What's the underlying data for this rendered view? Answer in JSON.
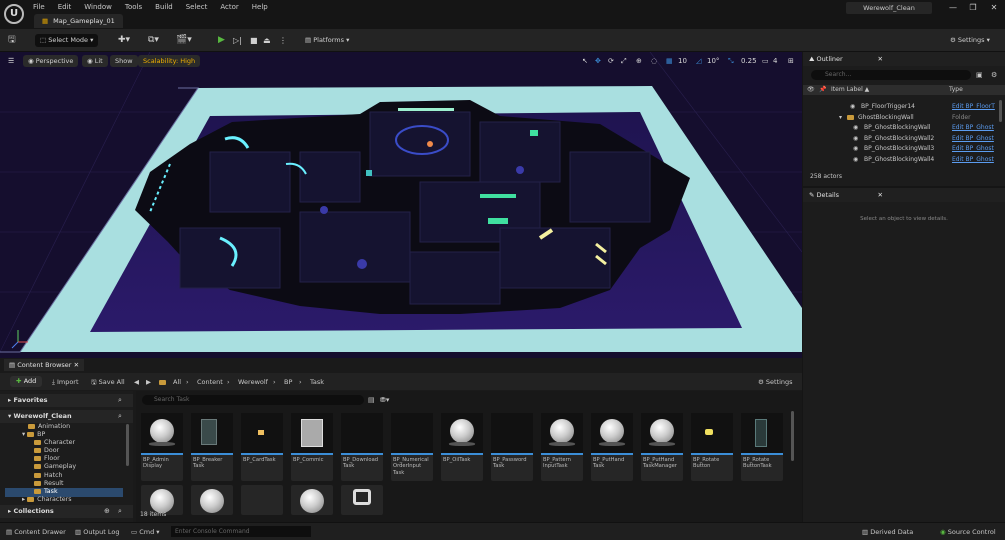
{
  "menu": [
    "File",
    "Edit",
    "Window",
    "Tools",
    "Build",
    "Select",
    "Actor",
    "Help"
  ],
  "map_tab": "Map_Gameplay_01",
  "project_name": "Werewolf_Clean",
  "toolbar": {
    "select_mode": "Select Mode",
    "platforms": "Platforms",
    "settings": "Settings"
  },
  "viewport": {
    "perspective": "Perspective",
    "lit": "Lit",
    "show": "Show",
    "scalability": "Scalability: High",
    "grid_snap": "10",
    "rot_snap": "10°",
    "scale_snap": "0.25",
    "cam_speed": "4"
  },
  "outliner": {
    "tab": "Outliner",
    "search_placeholder": "Search...",
    "col_label": "Item Label ▲",
    "col_type": "Type",
    "rows": [
      {
        "name": "BP_FloorTrigger14",
        "type": "Edit BP_FloorT"
      },
      {
        "name": "GhostBlockingWall",
        "type": "Folder"
      },
      {
        "name": "BP_GhostBlockingWall",
        "type": "Edit BP_Ghost"
      },
      {
        "name": "BP_GhostBlockingWall2",
        "type": "Edit BP_Ghost"
      },
      {
        "name": "BP_GhostBlockingWall3",
        "type": "Edit BP_Ghost"
      },
      {
        "name": "BP_GhostBlockingWall4",
        "type": "Edit BP_Ghost"
      }
    ],
    "actor_count": "258 actors"
  },
  "details": {
    "tab": "Details",
    "message": "Select an object to view details."
  },
  "content_browser": {
    "tab": "Content Browser",
    "add": "Add",
    "import": "Import",
    "save_all": "Save All",
    "path": [
      "All",
      "Content",
      "Werewolf",
      "BP",
      "Task"
    ],
    "settings": "Settings",
    "favorites": "Favorites",
    "project": "Werewolf_Clean",
    "tree": [
      "Animation",
      "BP",
      "Character",
      "Door",
      "Floor",
      "Gameplay",
      "Hatch",
      "Result",
      "Task",
      "Characters"
    ],
    "search_placeholder": "Search Task",
    "assets": [
      "BP_Admin Display",
      "BP_Breaker Task",
      "BP_CardTask",
      "BP_Commic",
      "BP_Download Task",
      "BP_Numerical OrderInput Task",
      "BP_OilTask",
      "BP_Password Task",
      "BP_Pattern InputTask",
      "BP_PutHand Task",
      "BP_PutHand TaskManager",
      "BP_Rotate Button",
      "BP_Rotate ButtonTask"
    ],
    "item_count": "18 items",
    "collections": "Collections"
  },
  "status": {
    "content_drawer": "Content Drawer",
    "output_log": "Output Log",
    "cmd": "Cmd",
    "console_placeholder": "Enter Console Command",
    "derived_data": "Derived Data",
    "source_control": "Source Control"
  },
  "colors": {
    "accent": "#3b8ed8",
    "play": "#58b840",
    "scalability": "#f0b000",
    "folder": "#c99a3b"
  }
}
